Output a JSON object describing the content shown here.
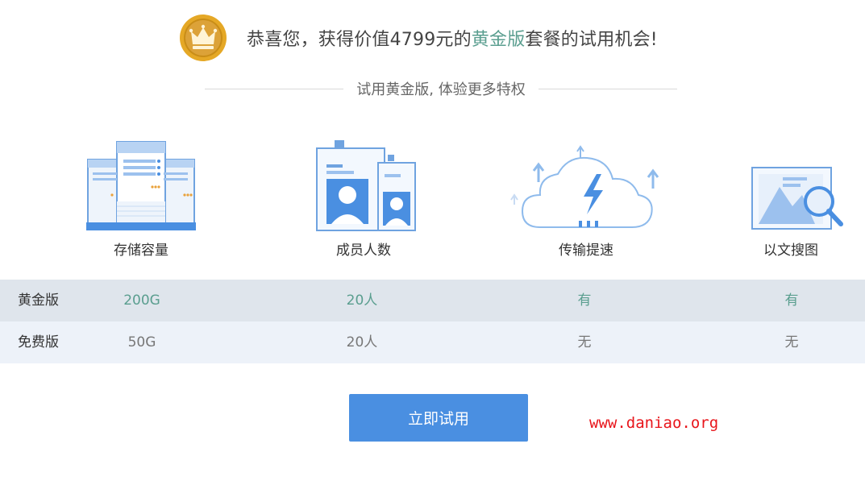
{
  "header": {
    "text_before": "恭喜您，获得价值4799元的",
    "highlight": "黄金版",
    "text_after": "套餐的试用机会!",
    "highlight_color": "#5a9e8f"
  },
  "subtitle": "试用黄金版, 体验更多特权",
  "features": [
    {
      "label": "存储容量",
      "icon": "server-storage-icon"
    },
    {
      "label": "成员人数",
      "icon": "member-badge-icon"
    },
    {
      "label": "传输提速",
      "icon": "cloud-speed-icon"
    },
    {
      "label": "以文搜图",
      "icon": "image-search-icon"
    }
  ],
  "plans": {
    "gold": {
      "name": "黄金版",
      "values": [
        "200G",
        "20人",
        "有",
        "有"
      ]
    },
    "free": {
      "name": "免费版",
      "values": [
        "50G",
        "20人",
        "无",
        "无"
      ]
    }
  },
  "cta": {
    "label": "立即试用",
    "color": "#4a8fe1"
  },
  "watermark": "www.daniao.org"
}
